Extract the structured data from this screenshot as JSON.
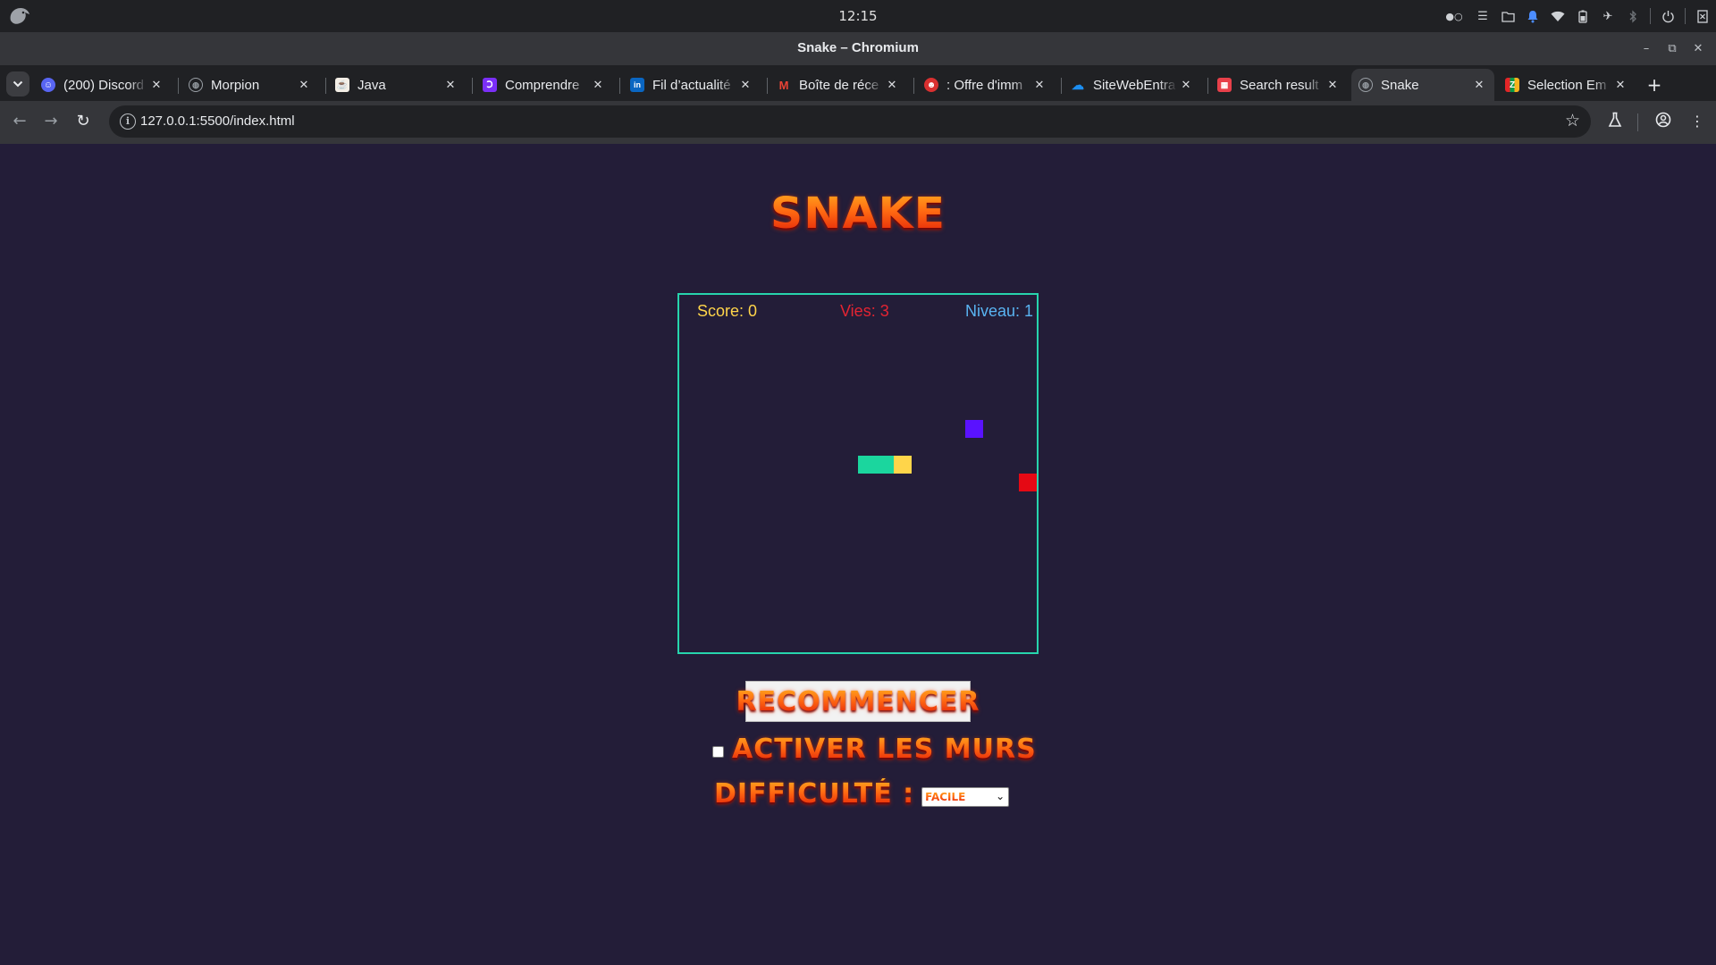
{
  "os": {
    "clock": "12:15",
    "tray_icons": [
      "record-indicator-icon",
      "menu-icon",
      "folder-icon",
      "bell-icon",
      "wifi-icon",
      "battery-icon",
      "airplane-icon",
      "bluetooth-icon",
      "power-icon",
      "logout-icon"
    ]
  },
  "window": {
    "title": "Snake – Chromium"
  },
  "tabs": [
    {
      "label": "(200) Discord",
      "favicon": "discord-icon",
      "color": "#5865f2",
      "active": false
    },
    {
      "label": "Morpion",
      "favicon": "globe-icon",
      "color": "#9aa0a6",
      "active": false
    },
    {
      "label": "Java",
      "favicon": "java-icon",
      "color": "#e76f00",
      "active": false
    },
    {
      "label": "Comprendre",
      "favicon": "c-icon",
      "color": "#7b2ff7",
      "active": false
    },
    {
      "label": "Fil d’actualité",
      "favicon": "linkedin-icon",
      "color": "#0a66c2",
      "active": false
    },
    {
      "label": "Boîte de réce",
      "favicon": "gmail-icon",
      "color": "#ea4335",
      "active": false
    },
    {
      "label": ": Offre d'imm",
      "favicon": "snapchat-icon",
      "color": "#d93030",
      "active": false
    },
    {
      "label": "SiteWebEntra",
      "favicon": "cloud-icon",
      "color": "#0078d4",
      "active": false
    },
    {
      "label": "Search result",
      "favicon": "store-icon",
      "color": "#e8404a",
      "active": false
    },
    {
      "label": "Snake",
      "favicon": "globe-icon",
      "color": "#9aa0a6",
      "active": true
    },
    {
      "label": "Selection Em",
      "favicon": "zoho-icon",
      "color": "#f4a20c",
      "active": false
    }
  ],
  "toolbar": {
    "url": "127.0.0.1:5500/index.html"
  },
  "game": {
    "title": "SNAKE",
    "score_label": "Score: 0",
    "lives_label": "Vies: 3",
    "level_label": "Niveau: 1",
    "colors": {
      "board_border": "#27d4ad",
      "snake_body": "#1bd69e",
      "snake_head": "#ffd54a",
      "food": "#5a12ff",
      "obstacle": "#e50914"
    },
    "restart_label": "RECOMMENCER",
    "walls_label": "ACTIVER LES MURS",
    "walls_checked": false,
    "difficulty_label": "DIFFICULTÉ :",
    "difficulty_value": "FACILE"
  }
}
